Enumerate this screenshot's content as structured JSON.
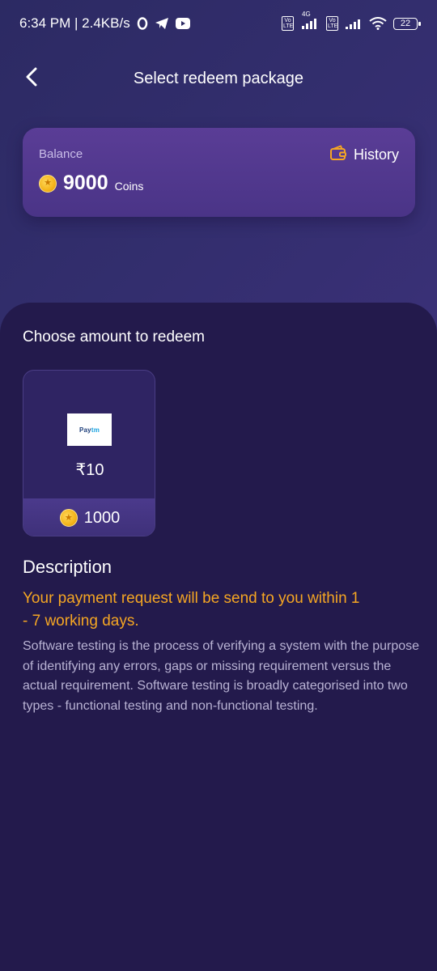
{
  "status_bar": {
    "time_speed": "6:34 PM | 2.4KB/s",
    "network_type": "4G",
    "lte_badge": "Vo LTE",
    "battery": "22",
    "icons": [
      "o-icon",
      "telegram-icon",
      "youtube-icon",
      "volte-icon",
      "signal-icon",
      "wifi-icon",
      "battery-icon"
    ]
  },
  "header": {
    "title": "Select redeem package",
    "back_icon": "chevron-left-icon"
  },
  "balance": {
    "label": "Balance",
    "amount": "9000",
    "unit": "Coins",
    "history_label": "History",
    "history_icon": "wallet-icon"
  },
  "redeem": {
    "section_title": "Choose amount to redeem",
    "packages": [
      {
        "provider": "Paytm",
        "logo_text_a": "Pay",
        "logo_text_b": "tm",
        "amount": "₹10",
        "coins": "1000"
      }
    ]
  },
  "description": {
    "title": "Description",
    "highlight": "Your payment request will be send to you within 1 - 7 working days.",
    "body": "Software testing is the process of verifying a system with the purpose of identifying any errors, gaps or missing requirement versus the actual requirement. Software testing is broadly categorised into two types - functional testing and non-functional testing."
  },
  "colors": {
    "background": "#231a4c",
    "card": "#4f3890",
    "accent": "#f5a623",
    "coin": "#f4b41a"
  }
}
